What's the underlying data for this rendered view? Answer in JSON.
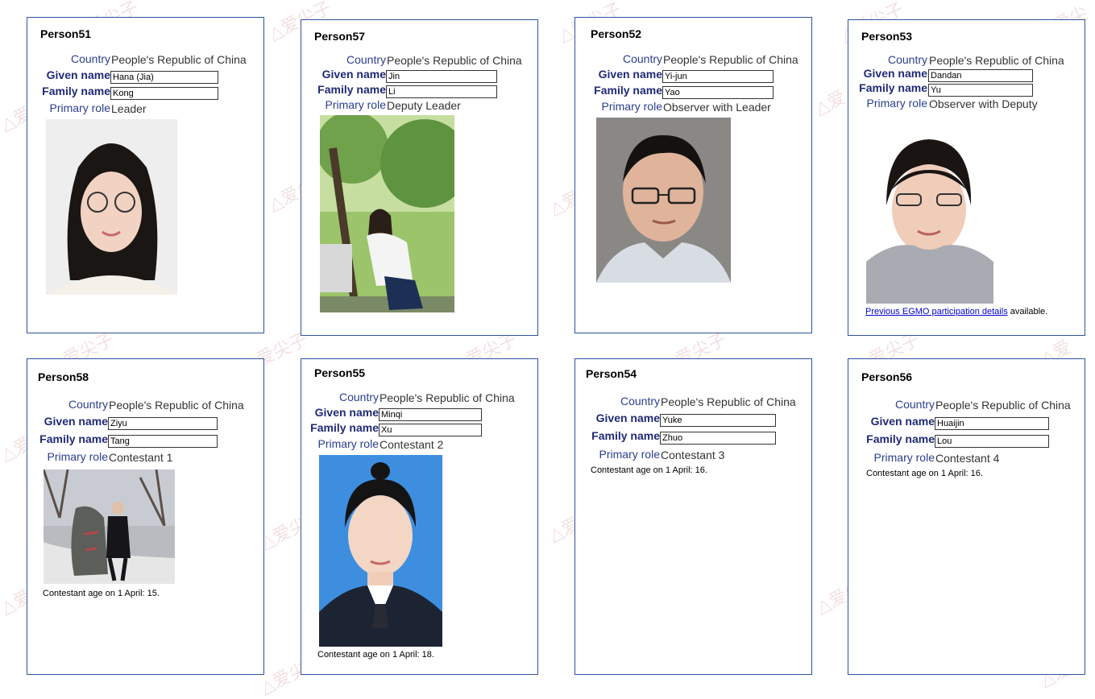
{
  "labels": {
    "country": "Country",
    "given_name": "Given name",
    "family_name": "Family name",
    "primary_role": "Primary role"
  },
  "persons": [
    {
      "id": "Person51",
      "country": "People's Republic of China",
      "given": "Hana (Jia)",
      "family": "Kong",
      "role": "Leader"
    },
    {
      "id": "Person57",
      "country": "People's Republic of China",
      "given": "Jin",
      "family": "Li",
      "role": "Deputy Leader"
    },
    {
      "id": "Person52",
      "country": "People's Republic of China",
      "given": "Yi-jun",
      "family": "Yao",
      "role": "Observer with Leader"
    },
    {
      "id": "Person53",
      "country": "People's Republic of China",
      "given": "Dandan",
      "family": "Yu",
      "role": "Observer with Deputy",
      "link_text": "Previous EGMO participation details",
      "link_suffix": " available."
    },
    {
      "id": "Person58",
      "country": "People's Republic of China",
      "given": "Ziyu",
      "family": "Tang",
      "role": "Contestant 1",
      "age_note": "Contestant age on 1 April: 15."
    },
    {
      "id": "Person55",
      "country": "People's Republic of China",
      "given": "Minqi",
      "family": "Xu",
      "role": "Contestant 2",
      "age_note": "Contestant age on 1 April: 18."
    },
    {
      "id": "Person54",
      "country": "People's Republic of China",
      "given": "Yuke",
      "family": "Zhuo",
      "role": "Contestant 3",
      "age_note": "Contestant age on 1 April: 16."
    },
    {
      "id": "Person56",
      "country": "People's Republic of China",
      "given": "Huaijin",
      "family": "Lou",
      "role": "Contestant 4",
      "age_note": "Contestant age on 1 April: 16."
    }
  ],
  "colors": {
    "border": "#2f52a0",
    "label": "#2a3f8f",
    "link": "#0000cc"
  }
}
